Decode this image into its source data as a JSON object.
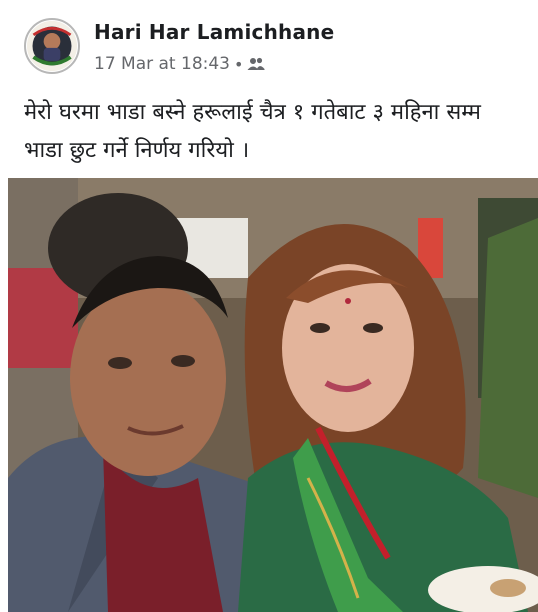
{
  "post": {
    "author": "Hari Har Lamichhane",
    "date": "17 Mar at 18:43",
    "separator": "•",
    "audience_icon": "friends-icon",
    "text_line1": "मेरो घरमा भाडा बस्ने हरूलाई चैत्र १ गतेबाट ३ महिना सम्म",
    "text_line2": "भाडा छुट गर्ने निर्णय गरियो ।"
  },
  "colors": {
    "name": "#1c1e21",
    "meta": "#65676b",
    "background": "#ffffff"
  }
}
